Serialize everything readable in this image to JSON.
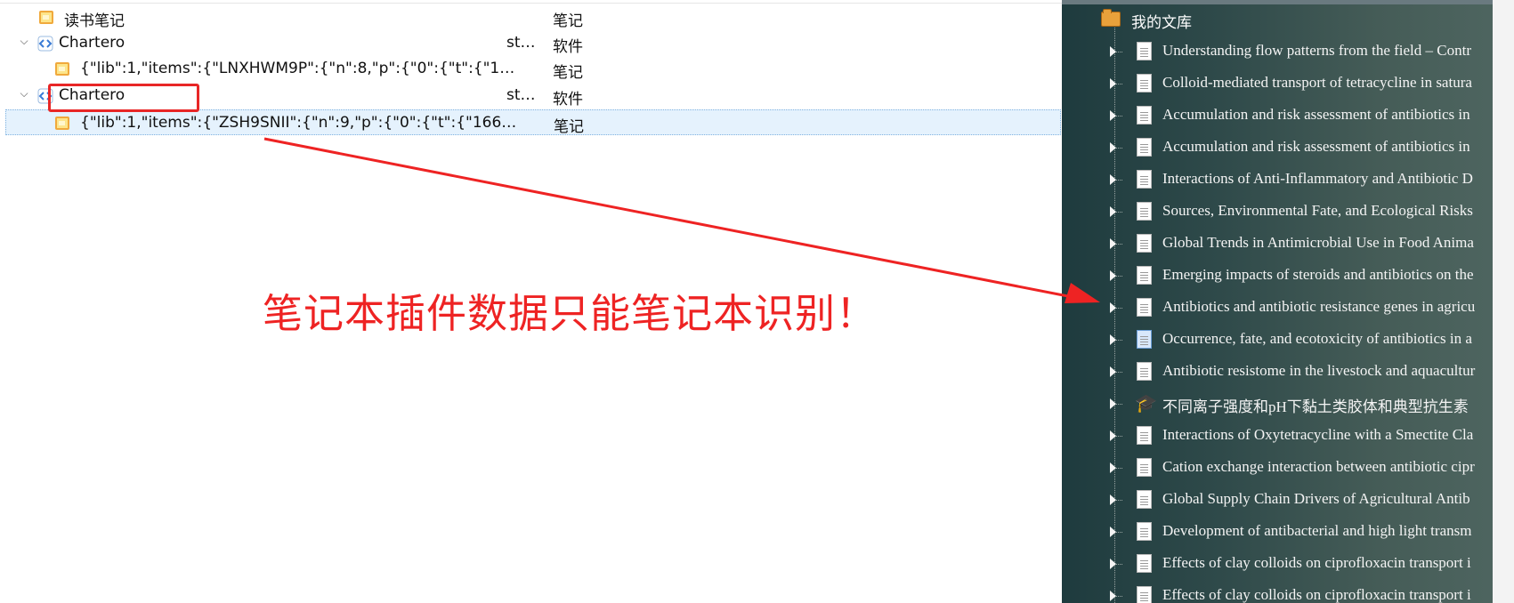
{
  "left_pane": {
    "rows": [
      {
        "title": "读书笔记",
        "creator": "",
        "type": "笔记",
        "kind": "note"
      },
      {
        "title": "Chartero",
        "creator": "st…",
        "type": "软件",
        "kind": "software"
      },
      {
        "title": "{\"lib\":1,\"items\":{\"LNXHWM9P\":{\"n\":8,\"p\":{\"0\":{\"t\":{\"1…",
        "creator": "",
        "type": "笔记",
        "kind": "note"
      },
      {
        "title": "Chartero",
        "creator": "st…",
        "type": "软件",
        "kind": "software"
      },
      {
        "title": "{\"lib\":1,\"items\":{\"ZSH9SNII\":{\"n\":9,\"p\":{\"0\":{\"t\":{\"166…",
        "creator": "",
        "type": "笔记",
        "kind": "note",
        "selected": true
      }
    ]
  },
  "annotation": {
    "text": "笔记本插件数据只能笔记本识别！",
    "color": "#ee2323"
  },
  "right_pane": {
    "library_label": "我的文库",
    "items": [
      {
        "title": "Understanding flow patterns from the field – Contr",
        "icon": "document-icon"
      },
      {
        "title": "Colloid-mediated transport of tetracycline in satura",
        "icon": "document-icon"
      },
      {
        "title": "Accumulation and risk assessment of antibiotics in",
        "icon": "document-icon"
      },
      {
        "title": "Accumulation and risk assessment of antibiotics in",
        "icon": "document-icon"
      },
      {
        "title": "Interactions of Anti-Inflammatory and Antibiotic D",
        "icon": "document-icon"
      },
      {
        "title": "Sources, Environmental Fate, and Ecological Risks",
        "icon": "document-icon"
      },
      {
        "title": "Global Trends in Antimicrobial Use in Food Anima",
        "icon": "document-icon"
      },
      {
        "title": "Emerging impacts of steroids and antibiotics on the",
        "icon": "document-icon"
      },
      {
        "title": "Antibiotics and antibiotic resistance genes in agricu",
        "icon": "document-icon"
      },
      {
        "title": "Occurrence, fate, and ecotoxicity of antibiotics in a",
        "icon": "blue-document-icon"
      },
      {
        "title": "Antibiotic resistome in the livestock and aquacultur",
        "icon": "document-icon"
      },
      {
        "title": "不同离子强度和pH下黏土类胶体和典型抗生素",
        "icon": "graduation-cap-icon"
      },
      {
        "title": "Interactions of Oxytetracycline with a Smectite Cla",
        "icon": "document-icon"
      },
      {
        "title": "Cation exchange interaction between antibiotic cipr",
        "icon": "document-icon"
      },
      {
        "title": "Global Supply Chain Drivers of Agricultural Antib",
        "icon": "document-icon"
      },
      {
        "title": "Development of antibacterial and high light transm",
        "icon": "document-icon"
      },
      {
        "title": "Effects of clay colloids on ciprofloxacin transport i",
        "icon": "document-icon"
      },
      {
        "title": "Effects of clay colloids on ciprofloxacin transport i",
        "icon": "document-icon"
      }
    ]
  }
}
